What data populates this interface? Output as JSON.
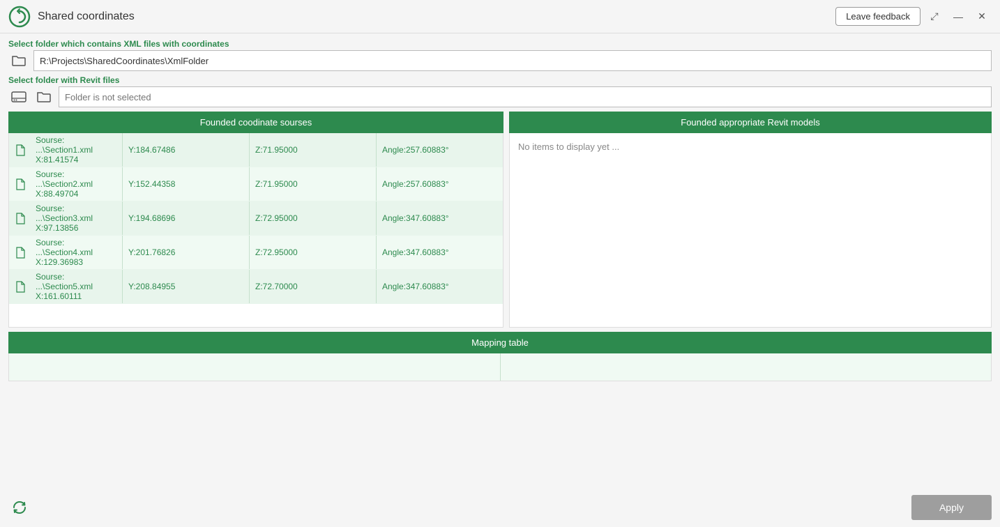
{
  "app": {
    "title": "Shared coordinates",
    "logo_color": "#2d8a4e"
  },
  "titlebar": {
    "feedback_label": "Leave feedback",
    "maximize_label": "⤢",
    "minimize_label": "—",
    "close_label": "✕"
  },
  "xml_section": {
    "label": "Select folder which contains XML files with coordinates",
    "path_value": "R:\\Projects\\SharedCoordinates\\XmlFolder",
    "path_placeholder": ""
  },
  "revit_section": {
    "label": "Select folder with Revit files",
    "path_value": "",
    "path_placeholder": "Folder is not selected"
  },
  "coord_table": {
    "header": "Founded coodinate sourses",
    "rows": [
      {
        "icon": "📄",
        "name": "Sourse: ...\\Section1.xml",
        "x": "X:81.41574",
        "y": "Y:184.67486",
        "z": "Z:71.95000",
        "angle": "Angle:257.60883°"
      },
      {
        "icon": "📄",
        "name": "Sourse: ...\\Section2.xml",
        "x": "X:88.49704",
        "y": "Y:152.44358",
        "z": "Z:71.95000",
        "angle": "Angle:257.60883°"
      },
      {
        "icon": "📄",
        "name": "Sourse: ...\\Section3.xml",
        "x": "X:97.13856",
        "y": "Y:194.68696",
        "z": "Z:72.95000",
        "angle": "Angle:347.60883°"
      },
      {
        "icon": "📄",
        "name": "Sourse: ...\\Section4.xml",
        "x": "X:129.36983",
        "y": "Y:201.76826",
        "z": "Z:72.95000",
        "angle": "Angle:347.60883°"
      },
      {
        "icon": "📄",
        "name": "Sourse: ...\\Section5.xml",
        "x": "X:161.60111",
        "y": "Y:208.84955",
        "z": "Z:72.70000",
        "angle": "Angle:347.60883°"
      }
    ]
  },
  "revit_table": {
    "header": "Founded appropriate Revit models",
    "empty_message": "No items to display yet ..."
  },
  "mapping_table": {
    "header": "Mapping table"
  },
  "bottom": {
    "apply_label": "Apply"
  }
}
